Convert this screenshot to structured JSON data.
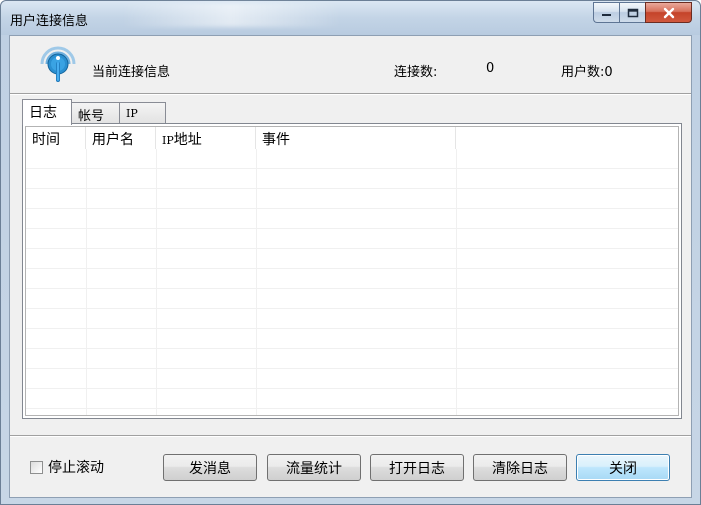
{
  "window": {
    "title": "用户连接信息"
  },
  "header": {
    "current_label": "当前连接信息",
    "connections_label": "连接数:",
    "connections_value": "0",
    "users_label": "用户数:0"
  },
  "tabs": [
    {
      "label": "日志",
      "active": true
    },
    {
      "label": "帐号",
      "active": false
    },
    {
      "label": "IP",
      "active": false
    }
  ],
  "table": {
    "columns": [
      "时间",
      "用户名",
      "IP地址",
      "事件",
      ""
    ],
    "column_ip_prefix": "IP",
    "column_ip_suffix": "地址",
    "rows": []
  },
  "footer": {
    "stop_scroll_label": "停止滚动",
    "stop_scroll_checked": false,
    "send_message_label": "发消息",
    "traffic_stats_label": "流量统计",
    "open_log_label": "打开日志",
    "clear_log_label": "清除日志",
    "close_label": "关闭"
  },
  "colors": {
    "accent_blue": "#3c7fb1",
    "close_red": "#c4432a",
    "icon_blue": "#2a8fd0"
  },
  "icons": {
    "app": "wireless-info-icon",
    "minimize": "minimize-icon",
    "maximize": "maximize-icon",
    "close": "close-icon"
  }
}
